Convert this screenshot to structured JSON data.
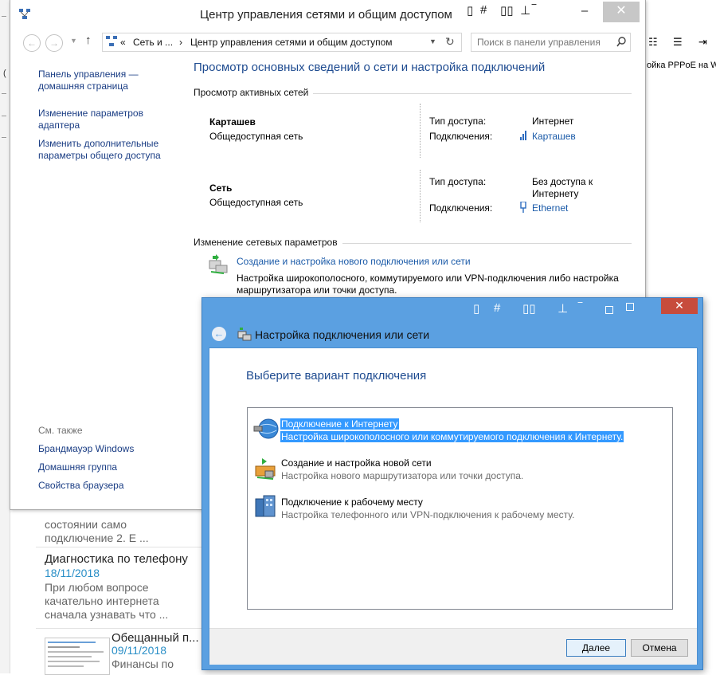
{
  "background": {
    "left_mark": "(",
    "toolbar_icons": [
      "list-icon",
      "bullet-list-icon",
      "indent-icon"
    ],
    "right_tag": "ойка PPPoE на W",
    "articles": [
      {
        "title": "",
        "date": "",
        "text": [
          "состоянии само",
          "подключение 2. Е ..."
        ]
      },
      {
        "title": "Диагностика по телефону",
        "date": "18/11/2018",
        "text": [
          "При любом вопросе",
          "качательно интернета",
          "сначала узнавать что ..."
        ]
      },
      {
        "title": "Обещанный п...",
        "date": "09/11/2018",
        "text": [
          "Финансы по"
        ]
      }
    ]
  },
  "main_window": {
    "title": "Центр управления сетями и общим доступом",
    "nav": {
      "address_prefix": "«",
      "crumb_1": "Сеть и ...",
      "crumb_sep": "›",
      "crumb_2": "Центр управления сетями и общим доступом",
      "search_placeholder": "Поиск в панели управления"
    },
    "left_pane": {
      "home_line1": "Панель управления —",
      "home_line2": "домашняя страница",
      "adapter_line1": "Изменение параметров",
      "adapter_line2": "адаптера",
      "sharing_line1": "Изменить дополнительные",
      "sharing_line2": "параметры общего доступа",
      "see_also": "См. также",
      "see_also_items": [
        "Брандмауэр Windows",
        "Домашняя группа",
        "Свойства браузера"
      ]
    },
    "heading": "Просмотр основных сведений о сети и настройка подключений",
    "active_networks_title": "Просмотр активных сетей",
    "networks": [
      {
        "name": "Карташев",
        "type": "Общедоступная сеть",
        "access_label": "Тип доступа:",
        "access_value": "Интернет",
        "access_value2": "",
        "conn_label": "Подключения:",
        "conn_value": "Карташев"
      },
      {
        "name": "Сеть",
        "type": "Общедоступная сеть",
        "access_label": "Тип доступа:",
        "access_value": "Без доступа к",
        "access_value2": "Интернету",
        "conn_label": "Подключения:",
        "conn_value": "Ethernet"
      }
    ],
    "change_section_title": "Изменение сетевых параметров",
    "new_connection_link": "Создание и настройка нового подключения или сети",
    "new_connection_desc_line1": "Настройка широкополосного, коммутируемого или VPN-подключения либо настройка",
    "new_connection_desc_line2": "маршрутизатора или точки доступа."
  },
  "wizard": {
    "title": "Настройка подключения или сети",
    "heading": "Выберите вариант подключения",
    "options": [
      {
        "title": "Подключение к Интернету",
        "desc": "Настройка широкополосного или коммутируемого подключения к Интернету.",
        "selected": true,
        "icon": "globe-icon"
      },
      {
        "title": "Создание и настройка новой сети",
        "desc": "Настройка нового маршрутизатора или точки доступа.",
        "selected": false,
        "icon": "router-icon"
      },
      {
        "title": "Подключение к рабочему месту",
        "desc": "Настройка телефонного или VPN-подключения к рабочему месту.",
        "selected": false,
        "icon": "workplace-icon"
      }
    ],
    "next_label": "Далее",
    "cancel_label": "Отмена"
  },
  "colors": {
    "heading_blue": "#1e4b90",
    "link_blue": "#1a5aa8",
    "wizard_frame": "#5ba0e1",
    "selection": "#3399ff",
    "close_red": "#c74c3c"
  }
}
